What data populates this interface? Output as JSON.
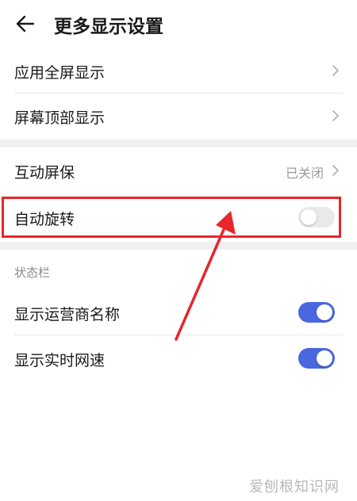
{
  "header": {
    "title": "更多显示设置",
    "back_icon": "arrow-left-icon"
  },
  "rows": {
    "fullscreen": {
      "label": "应用全屏显示"
    },
    "top_display": {
      "label": "屏幕顶部显示"
    },
    "screensaver": {
      "label": "互动屏保",
      "value": "已关闭"
    },
    "auto_rotate": {
      "label": "自动旋转",
      "toggle": "off"
    }
  },
  "status_bar": {
    "section_title": "状态栏",
    "carrier_name": {
      "label": "显示运营商名称",
      "toggle": "on"
    },
    "net_speed": {
      "label": "显示实时网速",
      "toggle": "on"
    }
  },
  "colors": {
    "accent": "#4a67e0",
    "annotation_red": "#e8262b"
  },
  "watermark": "爱刨根知识网"
}
